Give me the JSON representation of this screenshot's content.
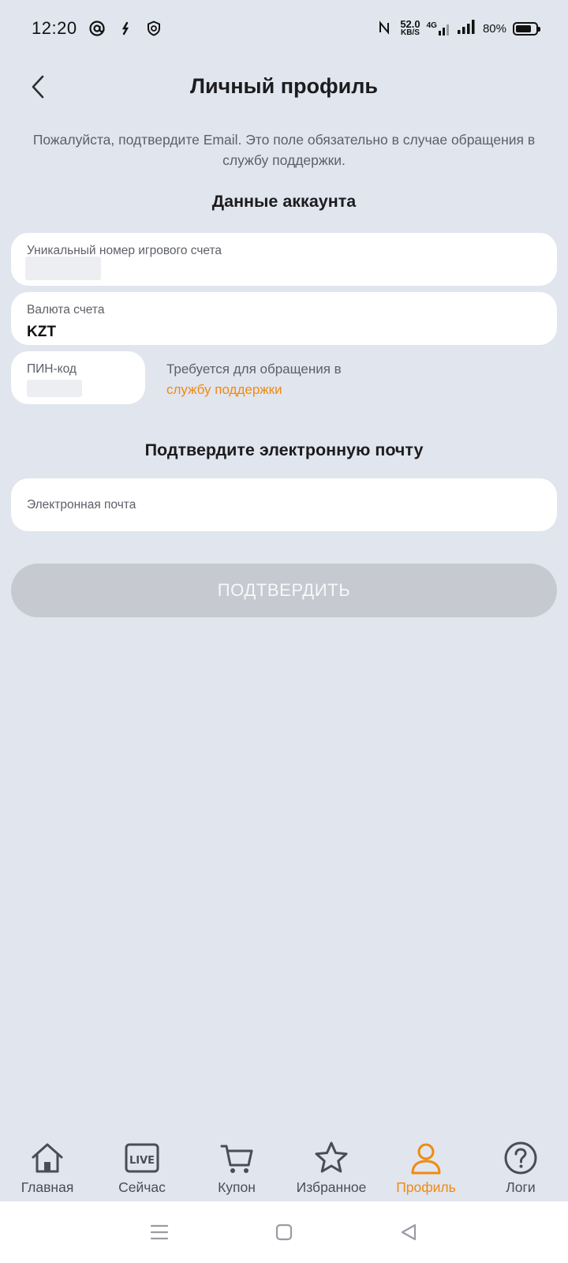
{
  "status_bar": {
    "time": "12:20",
    "speed_value": "52.0",
    "speed_unit": "KB/S",
    "network": "4G",
    "battery_percent": "80%",
    "battery_level": 0.8
  },
  "header": {
    "title": "Личный профиль"
  },
  "notice": "Пожалуйста, подтвердите Email. Это поле обязательно в случае обращения в службу поддержки.",
  "account_section": {
    "title": "Данные аккаунта",
    "account_number": {
      "label": "Уникальный номер игрового счета"
    },
    "currency": {
      "label": "Валюта счета",
      "value": "KZT"
    },
    "pin": {
      "label": "ПИН-код"
    },
    "pin_note": "Требуется для обращения в",
    "pin_link": "службу поддержки"
  },
  "email_section": {
    "title": "Подтвердите электронную почту",
    "email_placeholder": "Электронная почта"
  },
  "confirm_button": "ПОДТВЕРДИТЬ",
  "bottom_nav": {
    "items": [
      {
        "label": "Главная",
        "icon": "home-icon"
      },
      {
        "label": "Сейчас",
        "icon": "live-icon"
      },
      {
        "label": "Купон",
        "icon": "cart-icon"
      },
      {
        "label": "Избранное",
        "icon": "star-icon"
      },
      {
        "label": "Профиль",
        "icon": "profile-icon",
        "active": true
      },
      {
        "label": "Логи",
        "icon": "help-icon"
      }
    ]
  },
  "colors": {
    "background": "#e1e5ee",
    "accent": "#f08a10",
    "disabled_button": "#c6c9cf"
  }
}
